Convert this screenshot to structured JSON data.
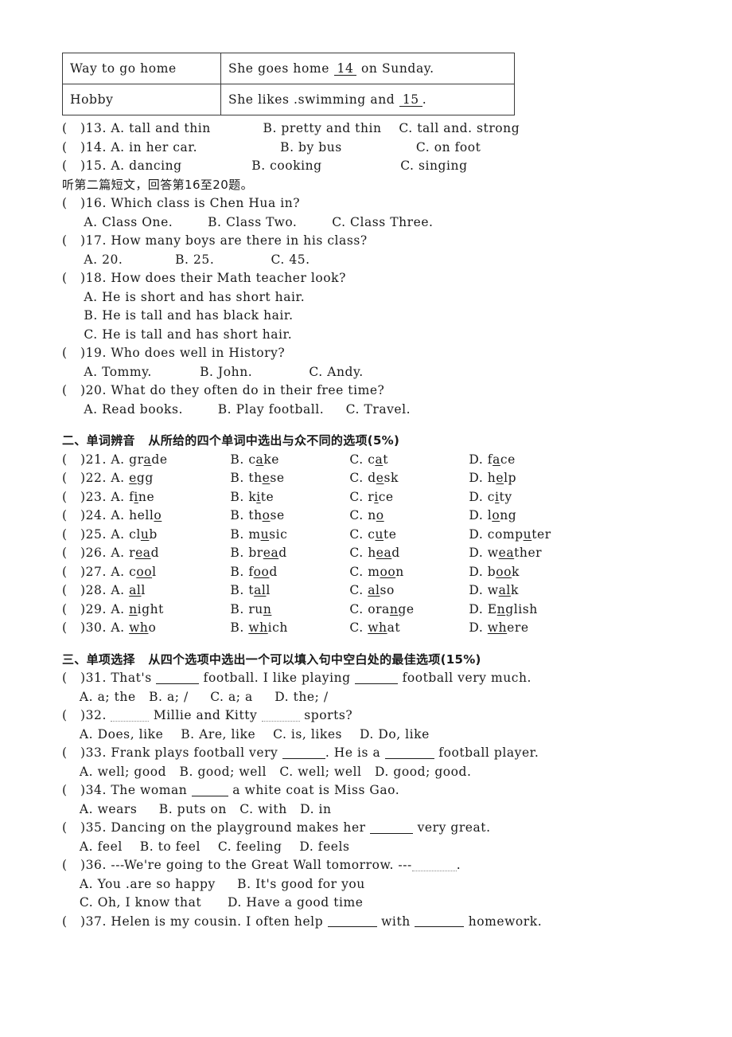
{
  "table": {
    "rows": [
      {
        "label": "Way to go home",
        "sentence_before": "She goes home ",
        "blank": "14",
        "sentence_after": "  on Sunday."
      },
      {
        "label": "Hobby",
        "sentence_before": "She likes .swimming and ",
        "blank": "15",
        "sentence_after": "."
      }
    ]
  },
  "listening": {
    "q13": "(   )13. A. tall and thin            B. pretty and thin    C. tall and. strong",
    "q14": "(   )14. A. in her car.                   B. by bus                 C. on foot",
    "q15": "(   )15. A. dancing                B. cooking                  C. singing",
    "instruction": "听第二篇短文，回答第16至20题。",
    "q16": "(   )16. Which class is Chen Hua in?",
    "q16opts": "     A. Class One.        B. Class Two.        C. Class Three.",
    "q17": "(   )17. How many boys are there in his class?",
    "q17opts": "     A. 20.            B. 25.             C. 45.",
    "q18": "(   )18. How does their Math teacher look?",
    "q18a": "     A. He is short and has short hair.",
    "q18b": "     B. He is tall and has black hair.",
    "q18c": "     C. He is tall and has short hair.",
    "q19": "(   )19. Who does well in History?",
    "q19opts": "     A. Tommy.           B. John.             C. Andy.",
    "q20": "(   )20. What do they often do in their free time?",
    "q20opts": "     A. Read books.        B. Play football.     C. Travel."
  },
  "section2": {
    "heading": "二、单词辨音",
    "hint": "从所给的四个单词中选出与众不同的选项(5%)",
    "questions": [
      {
        "num": "(   )21.",
        "options": [
          {
            "letter": "A.",
            "pre": "gr",
            "mid": "a",
            "post": "de",
            "pad": 12
          },
          {
            "letter": "B.",
            "pre": "c",
            "mid": "a",
            "post": "ke",
            "pad": 13
          },
          {
            "letter": "C.",
            "pre": "c",
            "mid": "a",
            "post": "t",
            "pad": 13
          },
          {
            "letter": "D.",
            "pre": "f",
            "mid": "a",
            "post": "ce",
            "pad": 11
          }
        ]
      },
      {
        "num": "(   )22.",
        "options": [
          {
            "letter": "A.",
            "pre": "",
            "mid": "e",
            "post": "gg",
            "pad": 12
          },
          {
            "letter": "B.",
            "pre": "th",
            "mid": "e",
            "post": "se",
            "pad": 13
          },
          {
            "letter": "C.",
            "pre": "d",
            "mid": "e",
            "post": "sk",
            "pad": 13
          },
          {
            "letter": "D.",
            "pre": "h",
            "mid": "e",
            "post": "lp",
            "pad": 11
          }
        ]
      },
      {
        "num": "(   )23.",
        "options": [
          {
            "letter": "A.",
            "pre": "f",
            "mid": "i",
            "post": "ne",
            "pad": 12
          },
          {
            "letter": "B.",
            "pre": "k",
            "mid": "i",
            "post": "te",
            "pad": 13
          },
          {
            "letter": "C.",
            "pre": "r",
            "mid": "i",
            "post": "ce",
            "pad": 13
          },
          {
            "letter": "D.",
            "pre": "c",
            "mid": "i",
            "post": "ty",
            "pad": 11
          }
        ]
      },
      {
        "num": "(   )24.",
        "options": [
          {
            "letter": "A.",
            "pre": "hell",
            "mid": "o",
            "post": "",
            "pad": 12
          },
          {
            "letter": "B.",
            "pre": "th",
            "mid": "o",
            "post": "se",
            "pad": 13
          },
          {
            "letter": "C.",
            "pre": "n",
            "mid": "o",
            "post": "",
            "pad": 13
          },
          {
            "letter": "D.",
            "pre": "l",
            "mid": "o",
            "post": "ng",
            "pad": 11
          }
        ]
      },
      {
        "num": "(   )25.",
        "options": [
          {
            "letter": "A.",
            "pre": "cl",
            "mid": "u",
            "post": "b",
            "pad": 12
          },
          {
            "letter": "B.",
            "pre": "m",
            "mid": "u",
            "post": "sic",
            "pad": 13
          },
          {
            "letter": "C.",
            "pre": "c",
            "mid": "u",
            "post": "te",
            "pad": 13
          },
          {
            "letter": "D.",
            "pre": "comp",
            "mid": "u",
            "post": "ter",
            "pad": 11
          }
        ]
      },
      {
        "num": "(   )26.",
        "options": [
          {
            "letter": "A.",
            "pre": "r",
            "mid": "ea",
            "post": "d",
            "pad": 12
          },
          {
            "letter": "B.",
            "pre": "br",
            "mid": "ea",
            "post": "d",
            "pad": 13
          },
          {
            "letter": "C.",
            "pre": "h",
            "mid": "ea",
            "post": "d",
            "pad": 13
          },
          {
            "letter": "D.",
            "pre": "w",
            "mid": "ea",
            "post": "ther",
            "pad": 11
          }
        ]
      },
      {
        "num": "(   )27.",
        "options": [
          {
            "letter": "A.",
            "pre": "c",
            "mid": "oo",
            "post": "l",
            "pad": 12
          },
          {
            "letter": "B.",
            "pre": "f",
            "mid": "oo",
            "post": "d",
            "pad": 13
          },
          {
            "letter": "C.",
            "pre": "m",
            "mid": "oo",
            "post": "n",
            "pad": 13
          },
          {
            "letter": "D.",
            "pre": "b",
            "mid": "oo",
            "post": "k",
            "pad": 11
          }
        ]
      },
      {
        "num": "(   )28.",
        "options": [
          {
            "letter": "A.",
            "pre": "",
            "mid": "al",
            "post": "l",
            "pad": 12
          },
          {
            "letter": "B.",
            "pre": "t",
            "mid": "al",
            "post": "l",
            "pad": 13
          },
          {
            "letter": "C.",
            "pre": "",
            "mid": "al",
            "post": "so",
            "pad": 13
          },
          {
            "letter": "D.",
            "pre": "w",
            "mid": "al",
            "post": "k",
            "pad": 11
          }
        ]
      },
      {
        "num": "(   )29.",
        "options": [
          {
            "letter": "A.",
            "pre": "",
            "mid": "n",
            "post": "ight",
            "pad": 12
          },
          {
            "letter": "B.",
            "pre": "ru",
            "mid": "n",
            "post": "",
            "pad": 13
          },
          {
            "letter": "C.",
            "pre": "ora",
            "mid": "n",
            "post": "ge",
            "pad": 13
          },
          {
            "letter": "D.",
            "pre": "E",
            "mid": "n",
            "post": "glish",
            "pad": 11
          }
        ]
      },
      {
        "num": "(   )30.",
        "options": [
          {
            "letter": "A.",
            "pre": "",
            "mid": "wh",
            "post": "o",
            "pad": 12
          },
          {
            "letter": "B.",
            "pre": "",
            "mid": "wh",
            "post": "ich",
            "pad": 13
          },
          {
            "letter": "C.",
            "pre": "",
            "mid": "wh",
            "post": "at",
            "pad": 13
          },
          {
            "letter": "D.",
            "pre": "",
            "mid": "wh",
            "post": "ere",
            "pad": 11
          }
        ]
      }
    ]
  },
  "section3": {
    "heading": "三、单项选择",
    "hint": "从四个选项中选出一个可以填入句中空白处的最佳选项(15%)",
    "q31_a": "(   )31. That's ",
    "q31_b": " football. I like playing ",
    "q31_c": " football very much.",
    "q31opts": "    A. a; the   B. a; /     C. a; a     D. the; /",
    "q32_a": "(   )32. ",
    "q32_b": " Millie and Kitty ",
    "q32_c": " sports?",
    "q32opts": "    A. Does, like    B. Are, like    C. is, likes    D. Do, like",
    "q33_a": "(   )33. Frank plays football very ",
    "q33_b": ". He is a ",
    "q33_c": " football player.",
    "q33opts": "    A. well; good   B. good; well   C. well; well   D. good; good.",
    "q34_a": "(   )34. The woman ",
    "q34_b": " a white coat is Miss Gao.",
    "q34opts": "    A. wears     B. puts on   C. with   D. in",
    "q35_a": "(   )35. Dancing on the playground makes her ",
    "q35_b": " very great.",
    "q35opts": "    A. feel    B. to feel    C. feeling    D. feels",
    "q36_a": "(   )36. ---We're going to the Great Wall tomorrow. ---",
    "q36_b": ".",
    "q36opts_ab": "    A. You .are so happy     B. It's good for you",
    "q36opts_cd": "    C. Oh, I know that      D. Have a good time",
    "q37_a": "(   )37. Helen is my cousin. I often help ",
    "q37_b": " with ",
    "q37_c": " homework."
  }
}
